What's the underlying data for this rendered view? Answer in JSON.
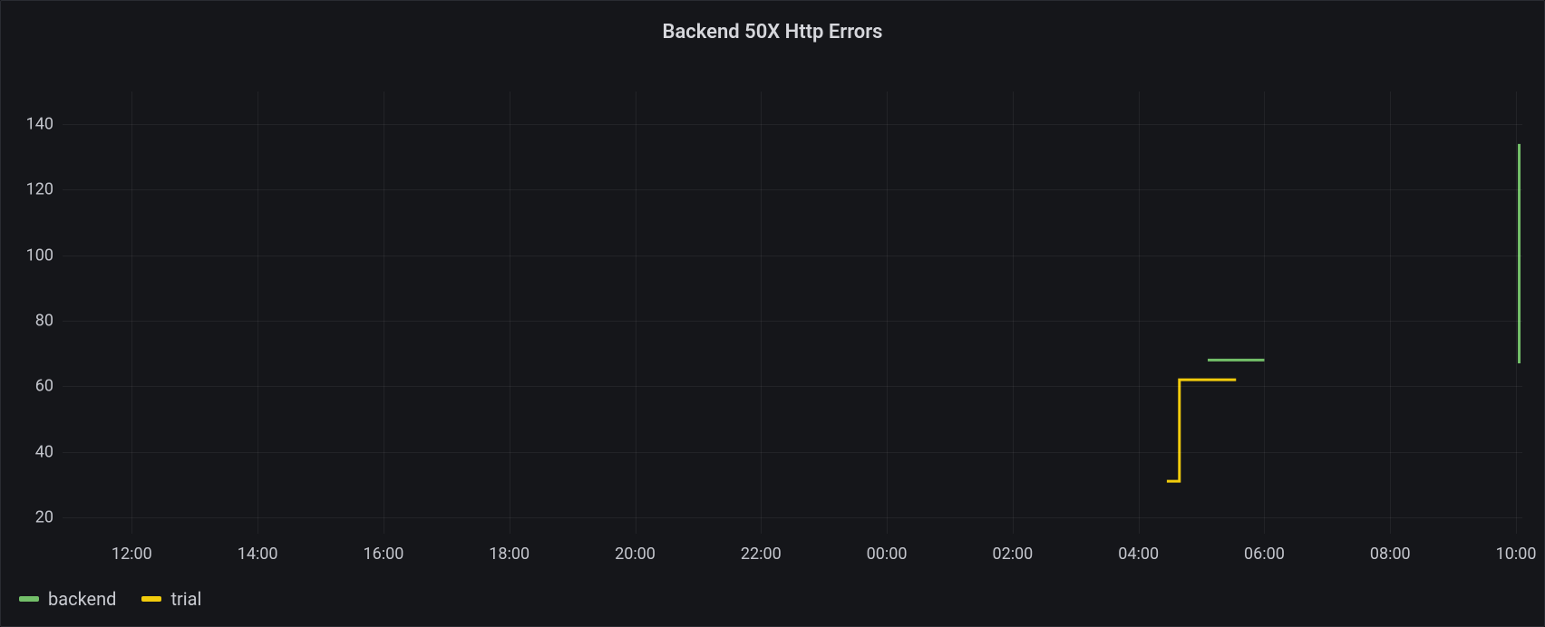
{
  "title": "Backend 50X Http Errors",
  "colors": {
    "backend": "#73bf69",
    "trial": "#f2cc0c"
  },
  "chart_data": {
    "type": "line",
    "title": "Backend 50X Http Errors",
    "xlabel": "",
    "ylabel": "",
    "ylim": [
      15,
      150
    ],
    "xlim_hours": [
      10.9,
      34.1
    ],
    "x_ticks": [
      "12:00",
      "14:00",
      "16:00",
      "18:00",
      "20:00",
      "22:00",
      "00:00",
      "02:00",
      "04:00",
      "06:00",
      "08:00",
      "10:00"
    ],
    "x_tick_hours": [
      12,
      14,
      16,
      18,
      20,
      22,
      24,
      26,
      28,
      30,
      32,
      34
    ],
    "y_ticks": [
      20,
      40,
      60,
      80,
      100,
      120,
      140
    ],
    "series": [
      {
        "name": "backend",
        "color": "#73bf69",
        "segments": [
          {
            "x_hours": [
              29.1,
              30.0
            ],
            "y": [
              68,
              68
            ]
          },
          {
            "x_hours": [
              34.05,
              34.05
            ],
            "y": [
              67,
              134
            ]
          }
        ]
      },
      {
        "name": "trial",
        "color": "#f2cc0c",
        "segments": [
          {
            "x_hours": [
              28.45,
              28.65,
              28.65,
              29.55
            ],
            "y": [
              31,
              31,
              62,
              62
            ]
          }
        ]
      }
    ]
  },
  "legend": [
    {
      "key": "backend",
      "label": "backend"
    },
    {
      "key": "trial",
      "label": "trial"
    }
  ]
}
